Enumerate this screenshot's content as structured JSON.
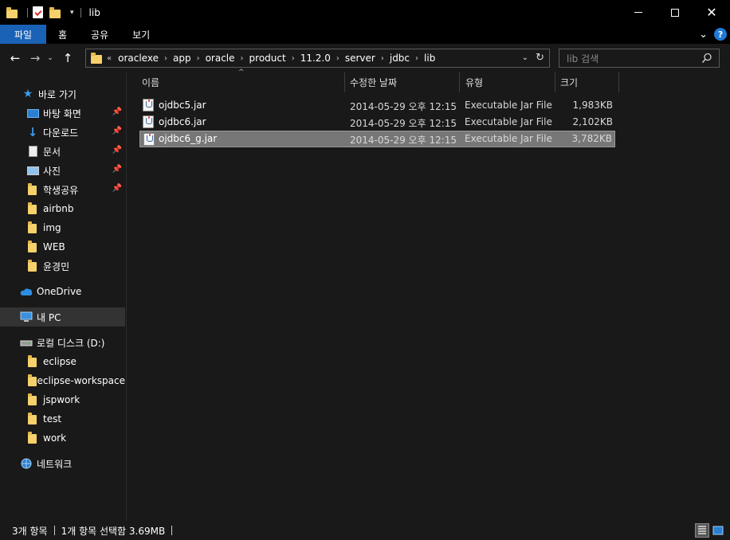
{
  "window": {
    "title": "lib"
  },
  "ribbon": {
    "tabs": [
      "파일",
      "홈",
      "공유",
      "보기"
    ]
  },
  "address": {
    "overflow": "«",
    "crumbs": [
      "oraclexe",
      "app",
      "oracle",
      "product",
      "11.2.0",
      "server",
      "jdbc",
      "lib"
    ],
    "search_placeholder": "lib 검색"
  },
  "nav": {
    "quick_access": "바로 가기",
    "pinned": [
      "바탕 화면",
      "다운로드",
      "문서",
      "사진",
      "학생공유"
    ],
    "folders": [
      "airbnb",
      "img",
      "WEB",
      "윤경민"
    ],
    "onedrive": "OneDrive",
    "this_pc": "내 PC",
    "drive": "로컬 디스크 (D:)",
    "drive_folders": [
      "eclipse",
      "eclipse-workspace",
      "jspwork",
      "test",
      "work"
    ],
    "network": "네트워크"
  },
  "columns": {
    "name": "이름",
    "date": "수정한 날짜",
    "type": "유형",
    "size": "크기"
  },
  "files": [
    {
      "name": "ojdbc5.jar",
      "date": "2014-05-29 오후 12:15",
      "type": "Executable Jar File",
      "size": "1,983KB"
    },
    {
      "name": "ojdbc6.jar",
      "date": "2014-05-29 오후 12:15",
      "type": "Executable Jar File",
      "size": "2,102KB"
    },
    {
      "name": "ojdbc6_g.jar",
      "date": "2014-05-29 오후 12:15",
      "type": "Executable Jar File",
      "size": "3,782KB"
    }
  ],
  "status": {
    "count": "3개 항목",
    "selection": "1개 항목 선택함 3.69MB"
  },
  "colors": {
    "accent": "#1a62b6",
    "folder": "#f6d06b",
    "selection_row": "#777777",
    "nav_selected": "#333333"
  }
}
